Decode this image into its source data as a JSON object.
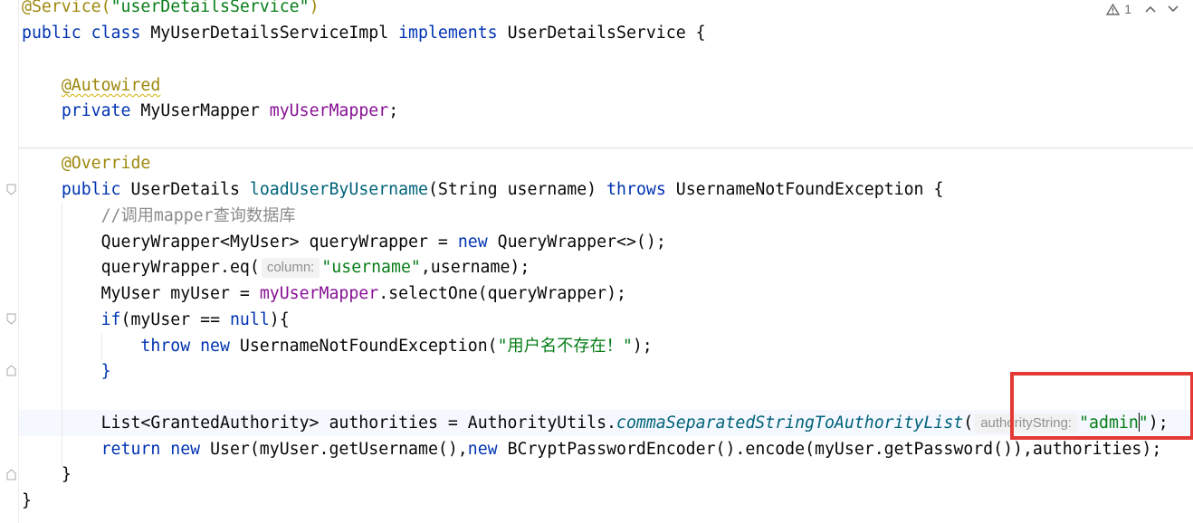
{
  "editor": {
    "inspection": {
      "icon": "warning-triangle-icon",
      "count": "1",
      "nav_up_icon": "chevron-up-icon",
      "nav_down_icon": "chevron-down-icon"
    },
    "lines": {
      "l0": {
        "t1": "@Service(",
        "t2": "\"userDetailsService\"",
        "t3": ")"
      },
      "l1": {
        "t1": "public class ",
        "t2": "MyUserDetailsServiceImpl ",
        "t3": "implements ",
        "t4": "UserDetailsService {"
      },
      "l3": {
        "t1": "@Autowired"
      },
      "l4": {
        "t1": "private ",
        "t2": "MyUserMapper ",
        "t3": "myUserMapper",
        "t4": ";"
      },
      "l6": {
        "t1": "@Override"
      },
      "l7": {
        "t1": "public ",
        "t2": "UserDetails ",
        "t3": "loadUserByUsername",
        "t4": "(String username) ",
        "t5": "throws ",
        "t6": "UsernameNotFoundException {"
      },
      "l8": {
        "t1": "//调用mapper查询数据库"
      },
      "l9": {
        "t1": "QueryWrapper<MyUser> queryWrapper = ",
        "t2": "new ",
        "t3": "QueryWrapper<>();"
      },
      "l10": {
        "t1": "queryWrapper.eq(",
        "hint": "column:",
        "t2": "\"username\"",
        "t3": ",username);"
      },
      "l11": {
        "t1": "MyUser myUser = ",
        "t2": "myUserMapper",
        "t3": ".selectOne(queryWrapper);"
      },
      "l12": {
        "t1": "if",
        "t2": "(myUser == ",
        "t3": "null",
        "t4": "){"
      },
      "l13": {
        "t1": "throw new ",
        "t2": "UsernameNotFoundException(",
        "t3": "\"用户名不存在！\"",
        "t4": ");"
      },
      "l14": {
        "t1": "}"
      },
      "l16": {
        "t1": "List<GrantedAuthority> authorities = AuthorityUtils.",
        "t2": "commaSeparatedStringToAuthorityList",
        "t3": "(",
        "hint": "authorityString:",
        "t4": "\"admin",
        "t5": "\"",
        "t6": ");"
      },
      "l17": {
        "t1": "return new ",
        "t2": "User(myUser.getUsername(),",
        "t3": "new ",
        "t4": "BCryptPasswordEncoder().encode(myUser.getPassword()),authorities);"
      },
      "l18": {
        "t1": "}"
      },
      "l19": {
        "t1": "}"
      }
    }
  }
}
